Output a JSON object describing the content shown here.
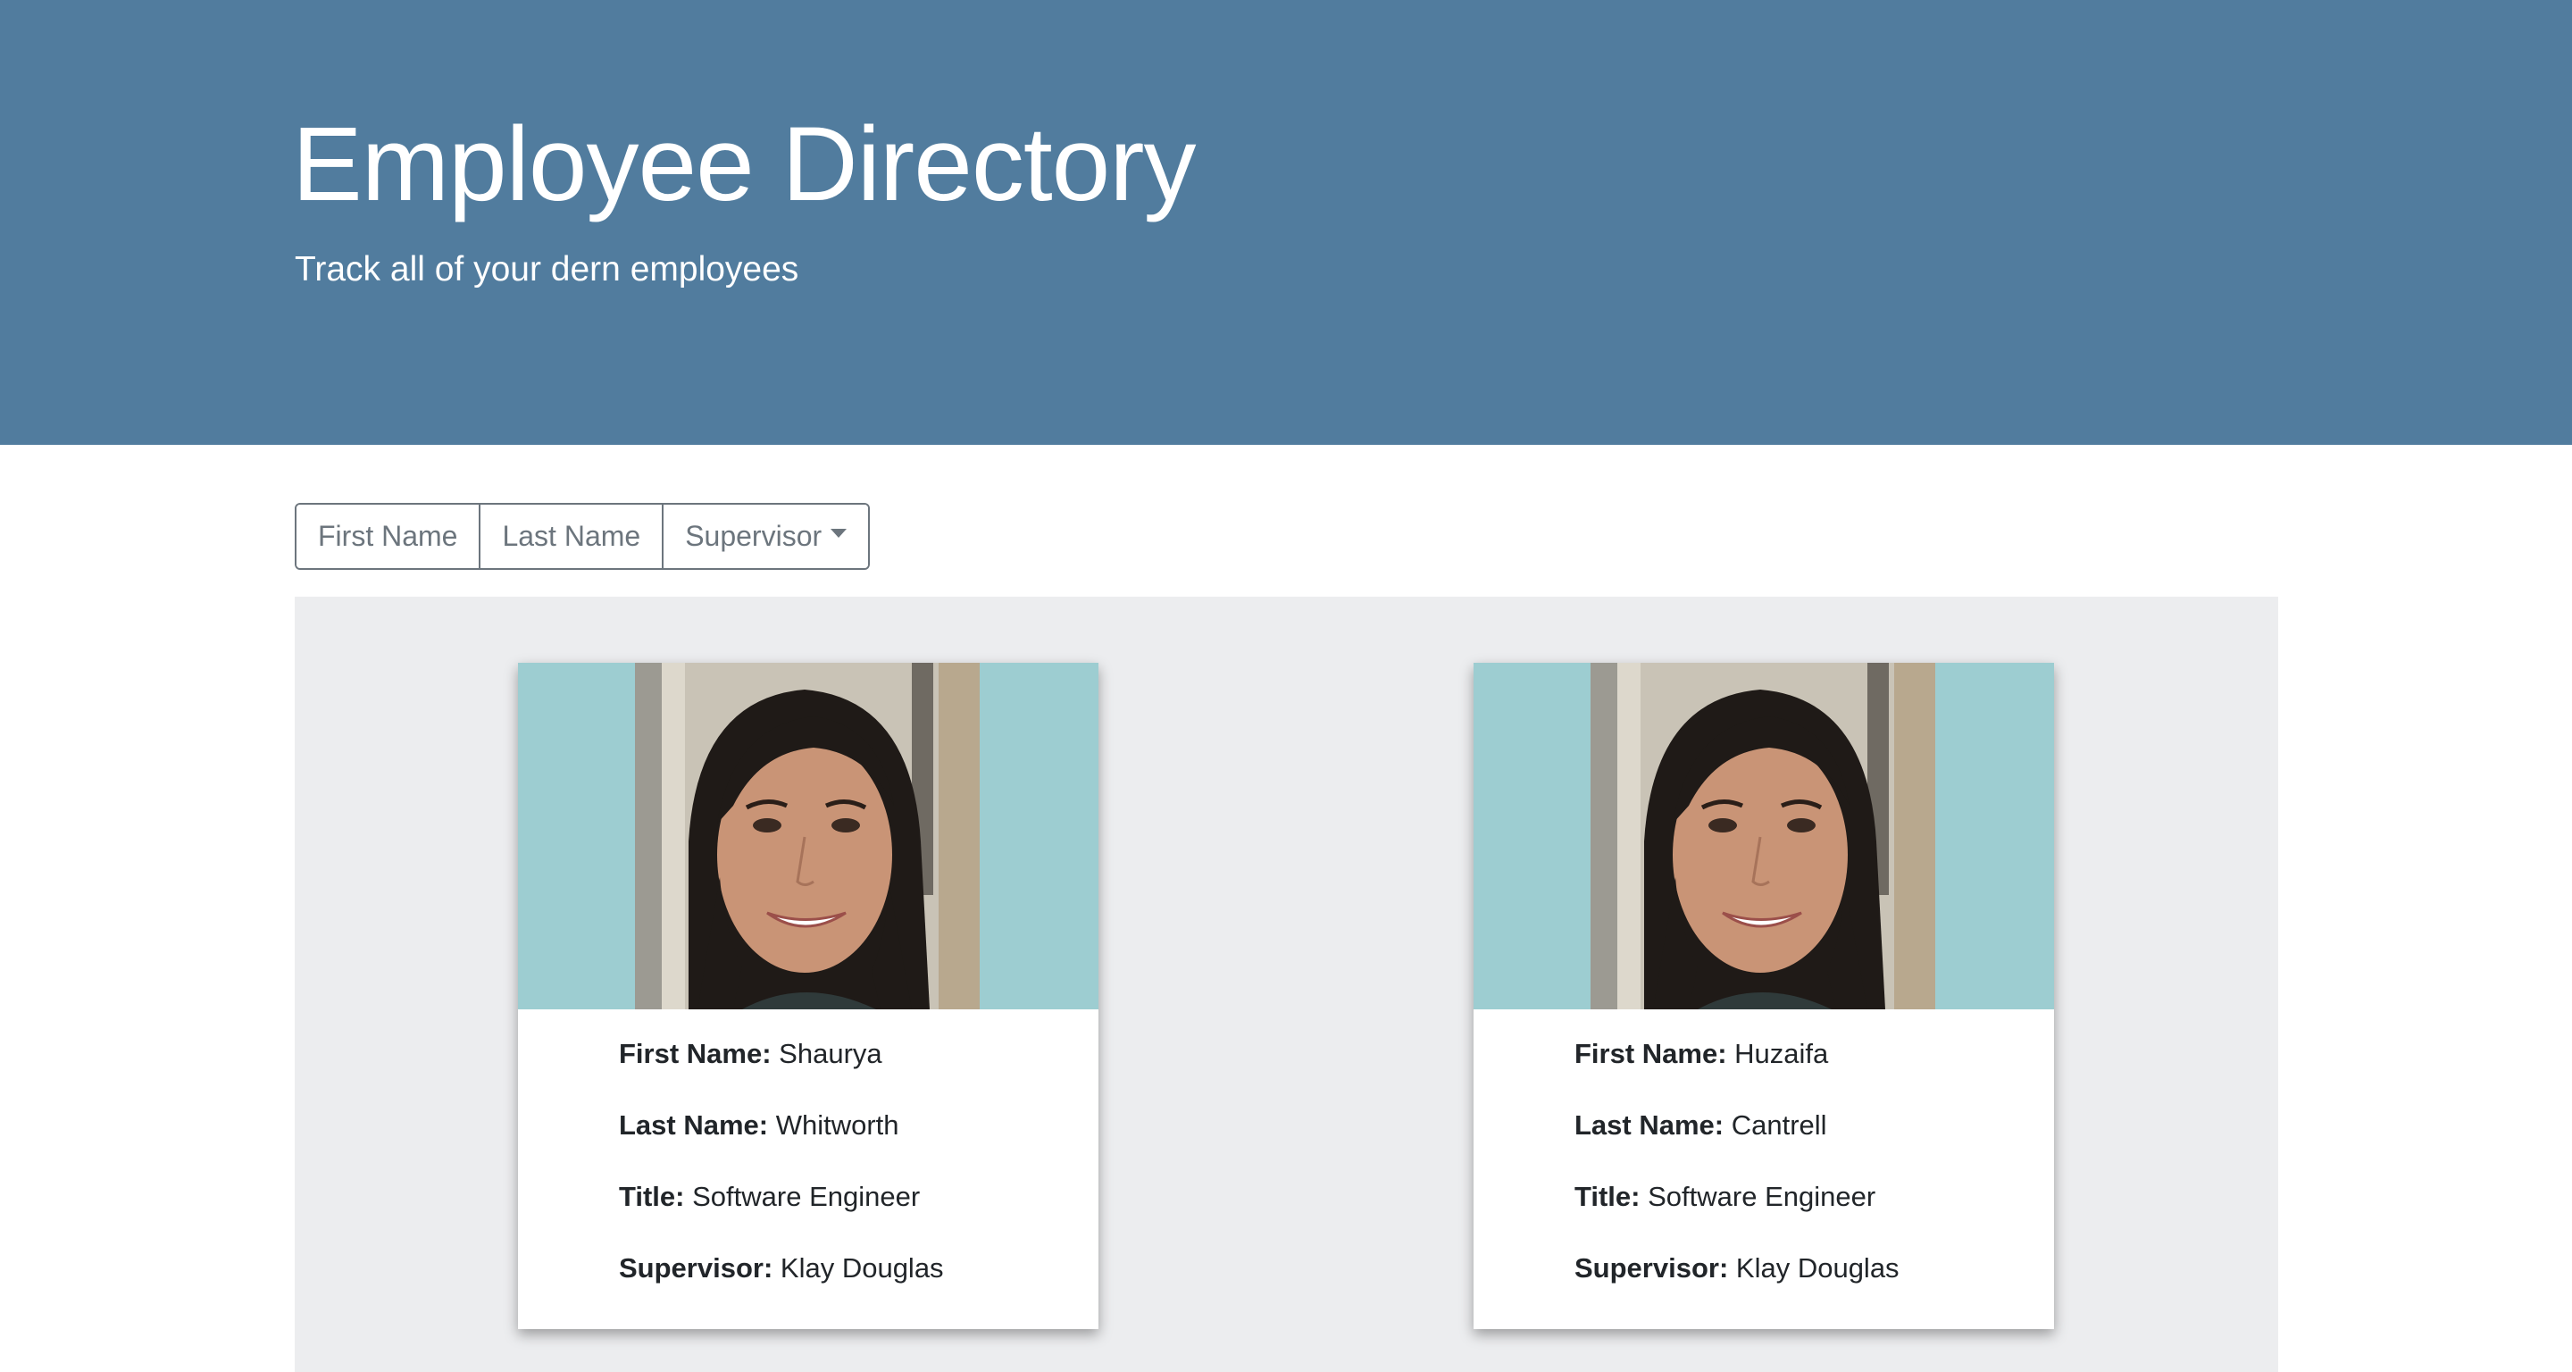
{
  "header": {
    "title": "Employee Directory",
    "subtitle": "Track all of your dern employees"
  },
  "sort_buttons": {
    "first_name": "First Name",
    "last_name": "Last Name",
    "supervisor": "Supervisor"
  },
  "employees": [
    {
      "first_name_label": "First Name:",
      "first_name": "Shaurya",
      "last_name_label": "Last Name:",
      "last_name": "Whitworth",
      "title_label": "Title:",
      "title": "Software Engineer",
      "supervisor_label": "Supervisor:",
      "supervisor": "Klay Douglas"
    },
    {
      "first_name_label": "First Name:",
      "first_name": "Huzaifa",
      "last_name_label": "Last Name:",
      "last_name": "Cantrell",
      "title_label": "Title:",
      "title": "Software Engineer",
      "supervisor_label": "Supervisor:",
      "supervisor": "Klay Douglas"
    }
  ],
  "colors": {
    "header_bg": "#517c9e",
    "card_image_bg": "#9dcdd1",
    "card_area_bg": "#ecedef",
    "button_border": "#6c757d"
  },
  "icons": {
    "supervisor_dropdown": "caret-down-icon"
  }
}
